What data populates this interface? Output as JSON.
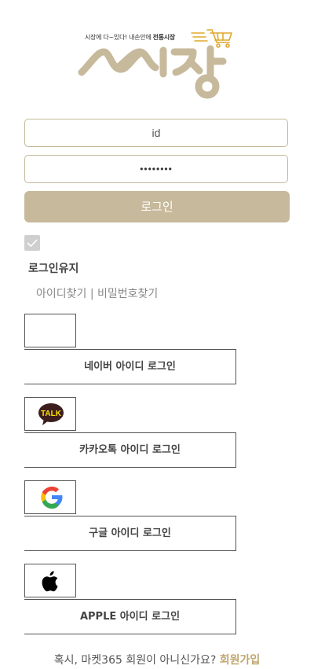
{
  "logo": {
    "tagline_prefix": "시장에 다~있다! 내손안에 ",
    "tagline_bold": "전통시장",
    "brand_color": "#c7b99b",
    "cart_color": "#e0a82e",
    "icon": "shopping-cart-icon"
  },
  "form": {
    "id_value": "id",
    "password_value": "••••••••",
    "login_label": "로그인"
  },
  "keep_login": {
    "label": "로그인유지",
    "checked": true
  },
  "find": {
    "find_id": "아이디찾기",
    "separator": " | ",
    "find_password": "비밀번호찾기"
  },
  "sns": {
    "naver_label": "네이버 아이디 로그인",
    "kakao_label": "카카오톡 아이디 로그인",
    "kakao_icon_text": "TALK",
    "google_label": "구글 아이디 로그인",
    "apple_label": "APPLE 아이디 로그인"
  },
  "signup": {
    "question": "혹시, 마켓365 회원이 아니신가요? ",
    "link": "회원가입"
  }
}
